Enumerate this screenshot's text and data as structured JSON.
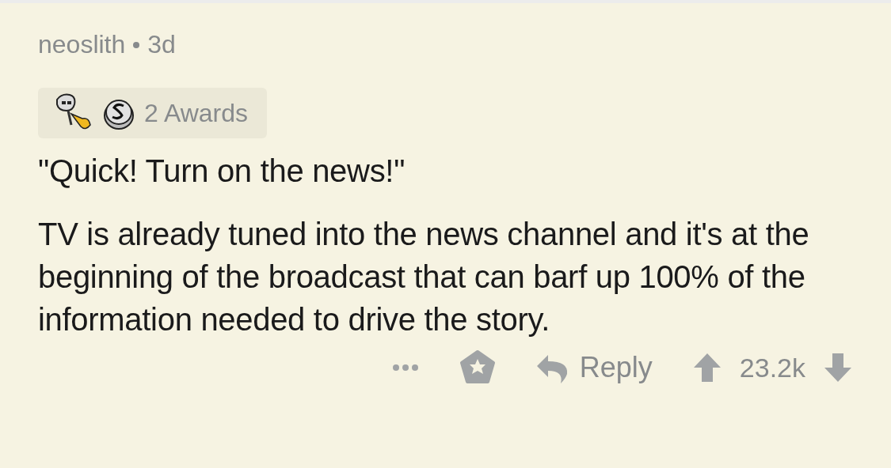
{
  "comment": {
    "author": "neoslith",
    "age": "3d",
    "awards": {
      "count_label": "2 Awards"
    },
    "title_line": "\"Quick! Turn on the news!\"",
    "body": "TV is already tuned into the news channel and it's at the beginning of the broadcast that can barf up 100% of the information needed to drive the story.",
    "actions": {
      "reply": "Reply",
      "score": "23.2k"
    }
  }
}
